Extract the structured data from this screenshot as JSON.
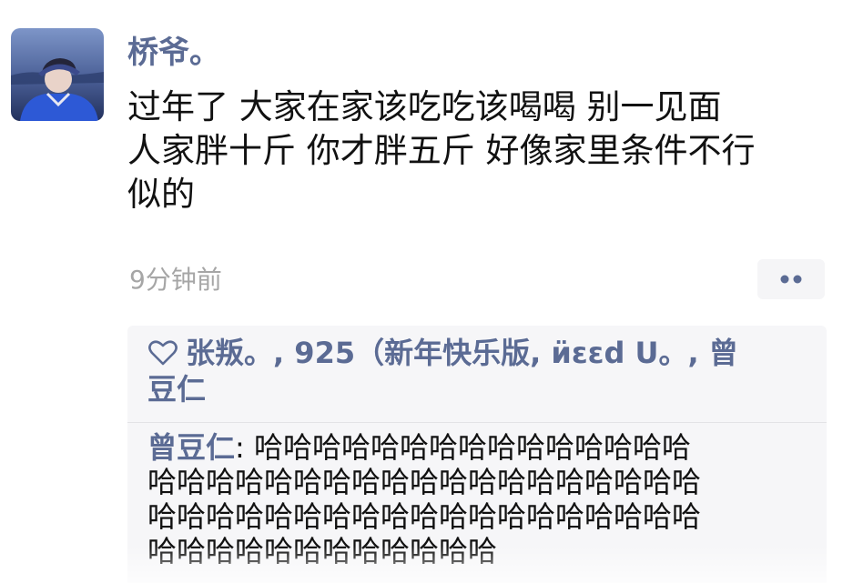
{
  "post": {
    "author": "桥爷。",
    "content_lines": [
      "过年了 大家在家该吃吃该喝喝 别一见面",
      "人家胖十斤 你才胖五斤 好像家里条件不行",
      "似的"
    ],
    "timestamp": "9分钟前",
    "more_icon": "more-dots-icon",
    "avatar_icon": "avatar-photo"
  },
  "likes": {
    "icon": "heart-icon",
    "lines": [
      "张叛。, 925（新年快乐版, ӥɛɛd ᑌ。, 曾",
      "豆仁"
    ]
  },
  "comment": {
    "author": "曾豆仁",
    "separator": ": ",
    "text_lines": [
      "哈哈哈哈哈哈哈哈哈哈哈哈哈哈哈",
      "哈哈哈哈哈哈哈哈哈哈哈哈哈哈哈哈哈哈哈",
      "哈哈哈哈哈哈哈哈哈哈哈哈哈哈哈哈哈哈哈",
      "哈哈哈哈哈哈哈哈哈哈哈哈"
    ]
  },
  "colors": {
    "name_blue": "#5b6b94",
    "timestamp_gray": "#a6a6a6",
    "panel_bg": "#f6f6f8"
  }
}
